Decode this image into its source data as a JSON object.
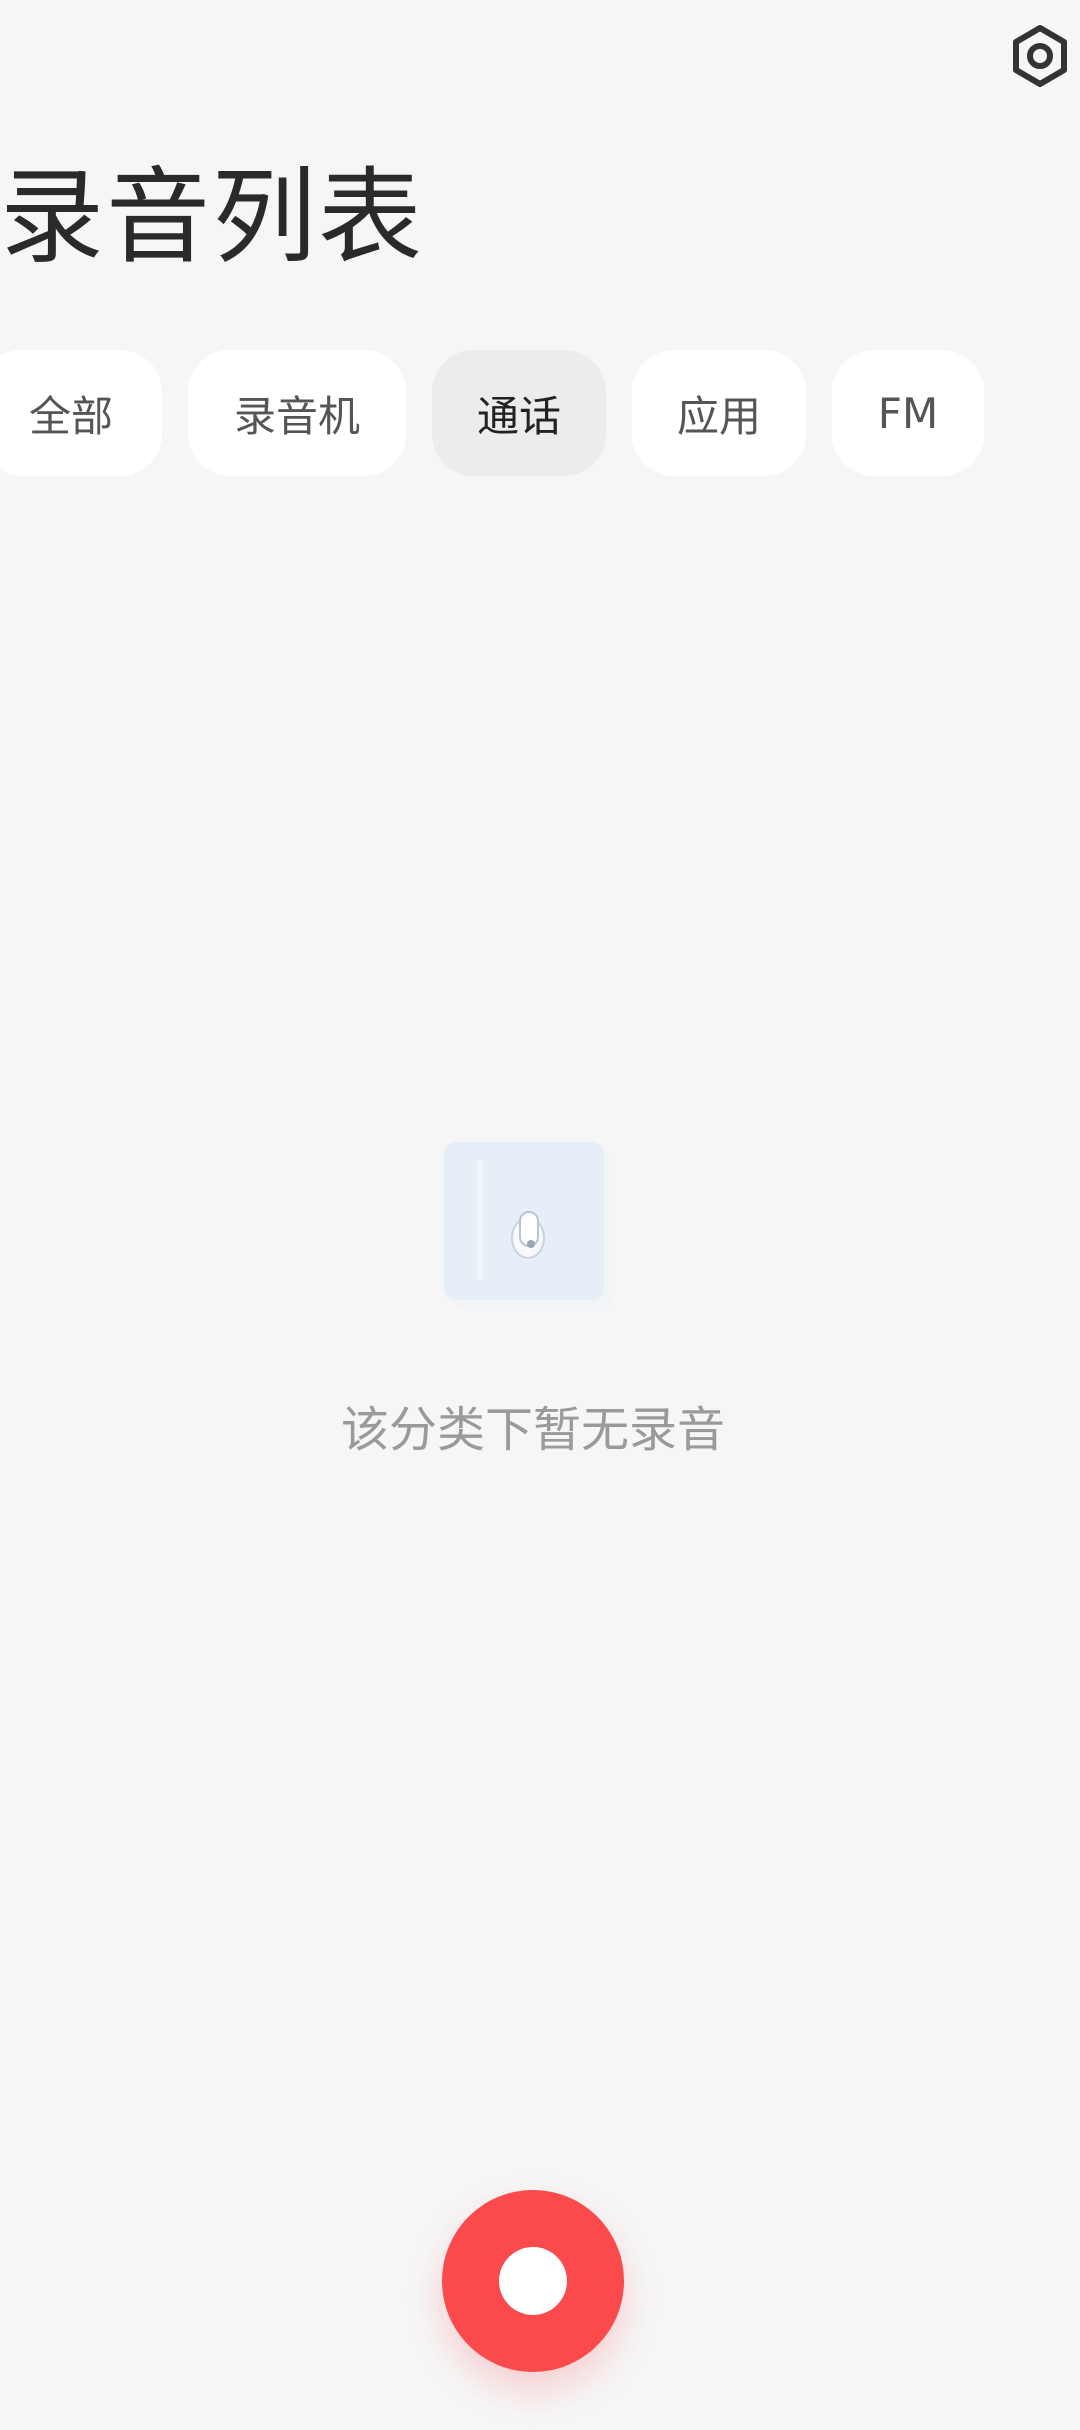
{
  "header": {
    "title": "录音列表",
    "settings_icon": "settings-hexagon-icon"
  },
  "tabs": [
    {
      "label": "全部",
      "active": false
    },
    {
      "label": "录音机",
      "active": false
    },
    {
      "label": "通话",
      "active": true
    },
    {
      "label": "应用",
      "active": false
    },
    {
      "label": "FM",
      "active": false
    }
  ],
  "empty_state": {
    "icon": "empty-recording-icon",
    "message": "该分类下暂无录音"
  },
  "record_button": {
    "icon": "record-icon",
    "color": "#fb4a4c"
  }
}
